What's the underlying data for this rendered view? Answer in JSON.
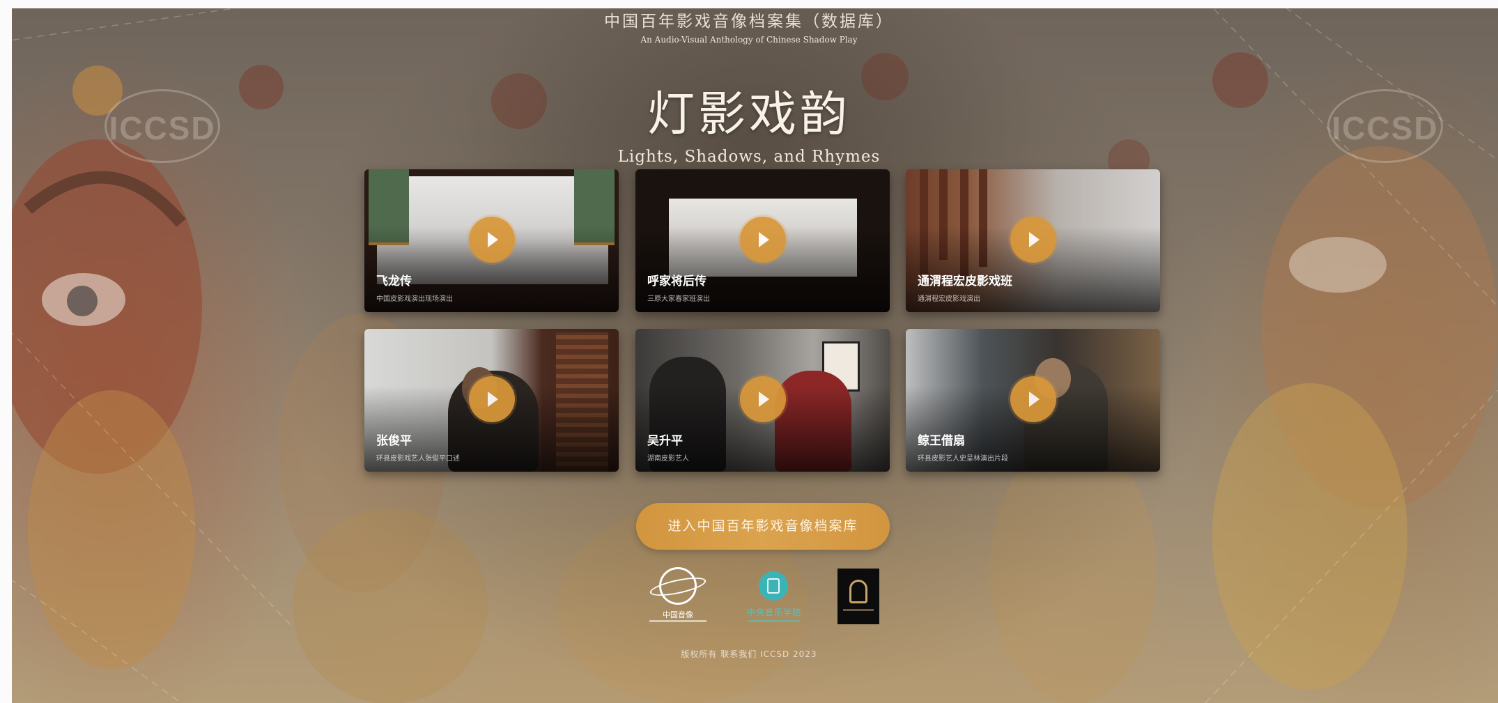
{
  "header": {
    "cn_subtitle": "中国百年影戏音像档案集（数据库）",
    "en_subtitle": "An Audio-Visual Anthology of Chinese Shadow Play",
    "title": "灯影戏韵",
    "en_title": "Lights, Shadows, and Rhymes"
  },
  "watermark": {
    "text": "ICCSD"
  },
  "videos": [
    {
      "title": "飞龙传",
      "subtitle": "中国皮影戏演出现场演出"
    },
    {
      "title": "呼家将后传",
      "subtitle": "三原大家春家班演出"
    },
    {
      "title": "通渭程宏皮影戏班",
      "subtitle": "通渭程宏皮影戏演出"
    },
    {
      "title": "张俊平",
      "subtitle": "环县皮影戏艺人张俊平口述"
    },
    {
      "title": "吴升平",
      "subtitle": "湖南皮影艺人"
    },
    {
      "title": "鲸王借扇",
      "subtitle": "环县皮影艺人史呈林演出片段"
    }
  ],
  "cta": {
    "label": "进入中国百年影戏音像档案库"
  },
  "logos": {
    "one": "中国音像",
    "two": "中央音乐学院"
  },
  "footer": {
    "text": "版权所有 联系我们 ICCSD 2023"
  },
  "colors": {
    "accent": "#d9983a",
    "teal": "#3bb4b7"
  }
}
